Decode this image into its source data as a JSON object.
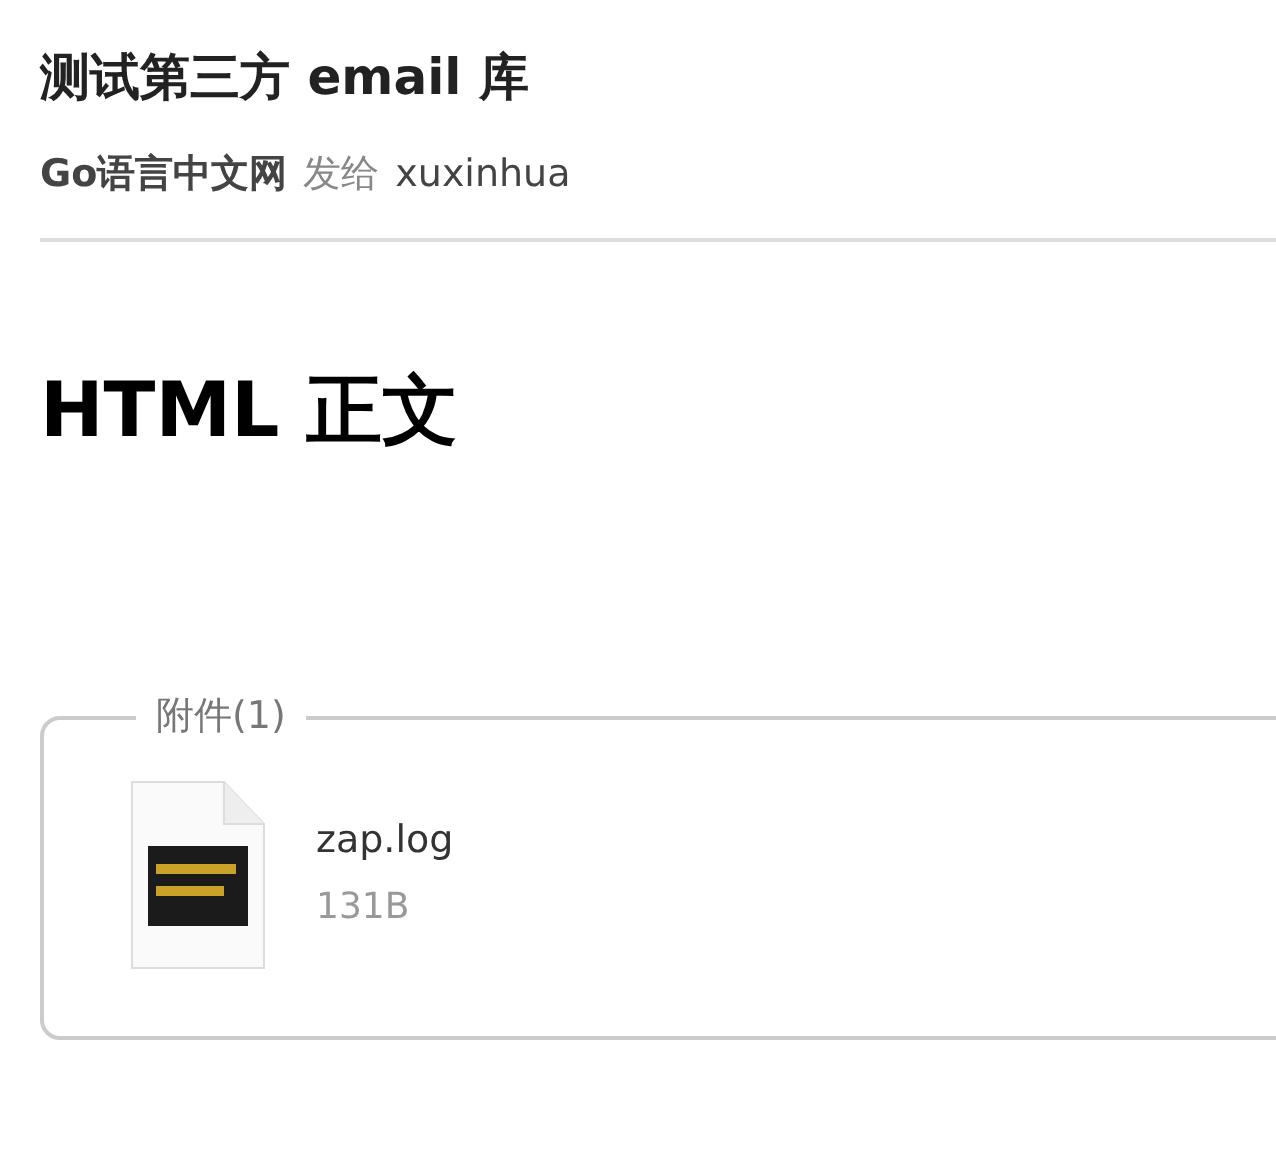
{
  "email": {
    "subject": "测试第三方 email 库",
    "sender": "Go语言中文网",
    "sent_to_label": "发给",
    "recipient": "xuxinhua"
  },
  "body": {
    "heading": "HTML 正文"
  },
  "attachments": {
    "legend": "附件(1)",
    "files": [
      {
        "name": "zap.log",
        "size": "131B"
      }
    ]
  }
}
